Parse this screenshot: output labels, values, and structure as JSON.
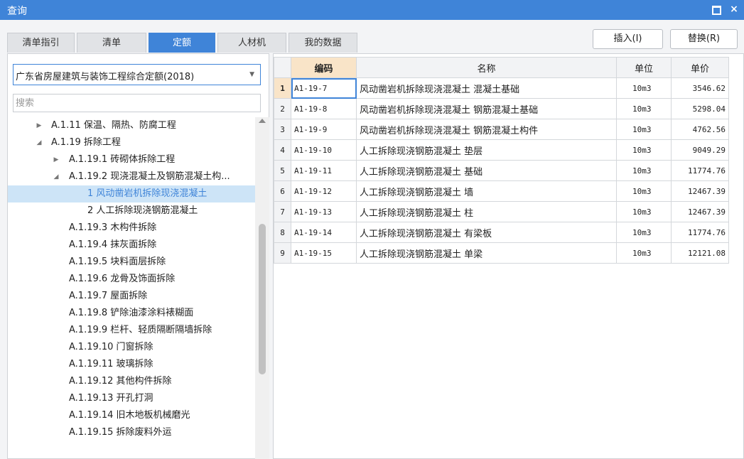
{
  "window": {
    "title": "查询",
    "maximize_icon": "maximize-icon",
    "close_icon": "close-icon",
    "close_glyph": "×"
  },
  "tabs": [
    {
      "label": "清单指引",
      "active": false
    },
    {
      "label": "清单",
      "active": false
    },
    {
      "label": "定额",
      "active": true
    },
    {
      "label": "人材机",
      "active": false
    },
    {
      "label": "我的数据",
      "active": false
    }
  ],
  "buttons": {
    "insert": "插入(I)",
    "replace": "替换(R)"
  },
  "quota_select": {
    "value": "广东省房屋建筑与装饰工程综合定额(2018)"
  },
  "search": {
    "placeholder": "搜索"
  },
  "tree": [
    {
      "label": "A.1.11 保温、隔热、防腐工程",
      "toggle": "collapsed"
    },
    {
      "label": "A.1.19 拆除工程",
      "toggle": "expanded"
    },
    {
      "label": "A.1.19.1 砖砌体拆除工程",
      "toggle": "collapsed"
    },
    {
      "label": "A.1.19.2 现浇混凝土及钢筋混凝土构...",
      "toggle": "expanded"
    },
    {
      "label": "1 风动凿岩机拆除现浇混凝土",
      "toggle": "none",
      "selected": true
    },
    {
      "label": "2 人工拆除现浇钢筋混凝土",
      "toggle": "none"
    },
    {
      "label": "A.1.19.3 木构件拆除",
      "toggle": "none"
    },
    {
      "label": "A.1.19.4 抹灰面拆除",
      "toggle": "none"
    },
    {
      "label": "A.1.19.5 块料面层拆除",
      "toggle": "none"
    },
    {
      "label": "A.1.19.6 龙骨及饰面拆除",
      "toggle": "none"
    },
    {
      "label": "A.1.19.7 屋面拆除",
      "toggle": "none"
    },
    {
      "label": "A.1.19.8 铲除油漆涂料裱糊面",
      "toggle": "none"
    },
    {
      "label": "A.1.19.9 栏杆、轻质隔断隔墙拆除",
      "toggle": "none"
    },
    {
      "label": "A.1.19.10 门窗拆除",
      "toggle": "none"
    },
    {
      "label": "A.1.19.11 玻璃拆除",
      "toggle": "none"
    },
    {
      "label": "A.1.19.12 其他构件拆除",
      "toggle": "none"
    },
    {
      "label": "A.1.19.13 开孔打洞",
      "toggle": "none"
    },
    {
      "label": "A.1.19.14 旧木地板机械磨光",
      "toggle": "none"
    },
    {
      "label": "A.1.19.15 拆除废料外运",
      "toggle": "none"
    }
  ],
  "grid": {
    "columns": {
      "code": "编码",
      "name": "名称",
      "unit": "单位",
      "price": "单价"
    },
    "rows": [
      {
        "no": "1",
        "code": "A1-19-7",
        "name": "风动凿岩机拆除现浇混凝土 混凝土基础",
        "unit": "10m3",
        "price": "3546.62"
      },
      {
        "no": "2",
        "code": "A1-19-8",
        "name": "风动凿岩机拆除现浇混凝土 钢筋混凝土基础",
        "unit": "10m3",
        "price": "5298.04"
      },
      {
        "no": "3",
        "code": "A1-19-9",
        "name": "风动凿岩机拆除现浇混凝土 钢筋混凝土构件",
        "unit": "10m3",
        "price": "4762.56"
      },
      {
        "no": "4",
        "code": "A1-19-10",
        "name": "人工拆除现浇钢筋混凝土 垫层",
        "unit": "10m3",
        "price": "9049.29"
      },
      {
        "no": "5",
        "code": "A1-19-11",
        "name": "人工拆除现浇钢筋混凝土 基础",
        "unit": "10m3",
        "price": "11774.76"
      },
      {
        "no": "6",
        "code": "A1-19-12",
        "name": "人工拆除现浇钢筋混凝土 墙",
        "unit": "10m3",
        "price": "12467.39"
      },
      {
        "no": "7",
        "code": "A1-19-13",
        "name": "人工拆除现浇钢筋混凝土 柱",
        "unit": "10m3",
        "price": "12467.39"
      },
      {
        "no": "8",
        "code": "A1-19-14",
        "name": "人工拆除现浇钢筋混凝土 有梁板",
        "unit": "10m3",
        "price": "11774.76"
      },
      {
        "no": "9",
        "code": "A1-19-15",
        "name": "人工拆除现浇钢筋混凝土 单梁",
        "unit": "10m3",
        "price": "12121.08"
      }
    ]
  },
  "colors": {
    "accent": "#3f84d8",
    "selected_row_bg": "#cde4f7",
    "header_highlight": "#f9e4c8"
  }
}
